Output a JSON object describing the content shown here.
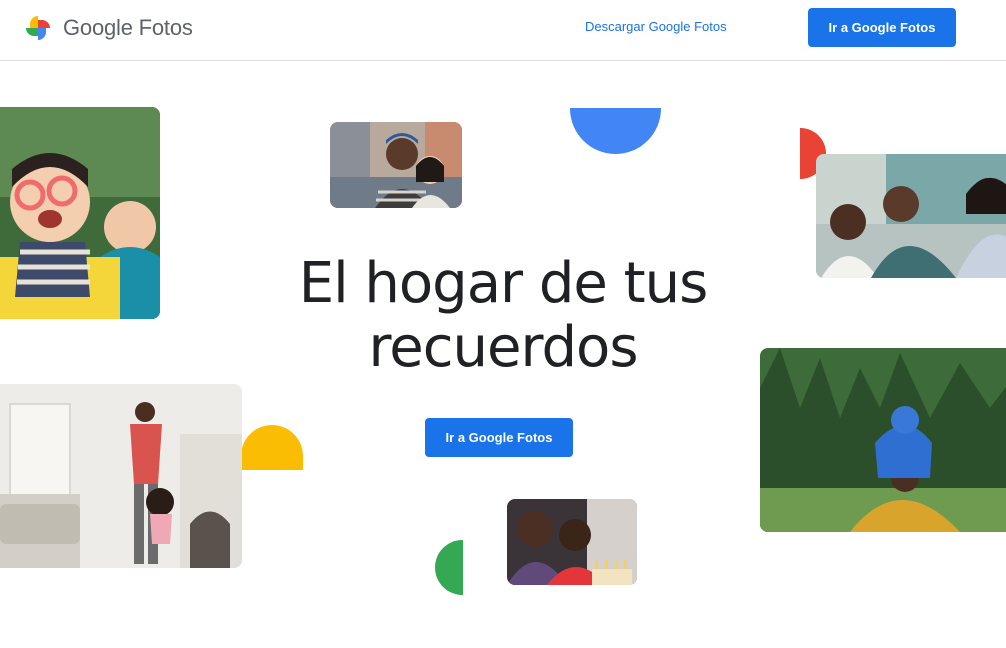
{
  "header": {
    "brand": "Google Fotos",
    "download_link": "Descargar Google Fotos",
    "cta_label": "Ir a Google Fotos"
  },
  "hero": {
    "headline": "El hogar de tus recuerdos",
    "cta_label": "Ir a Google Fotos"
  },
  "icons": {
    "logo": "google-photos-pinwheel-icon"
  },
  "colors": {
    "primary": "#1a73e8",
    "blue": "#4285f4",
    "red": "#ea4335",
    "yellow": "#fbbc04",
    "green": "#34a853",
    "text": "#202124",
    "brand_text": "#5f6368"
  }
}
